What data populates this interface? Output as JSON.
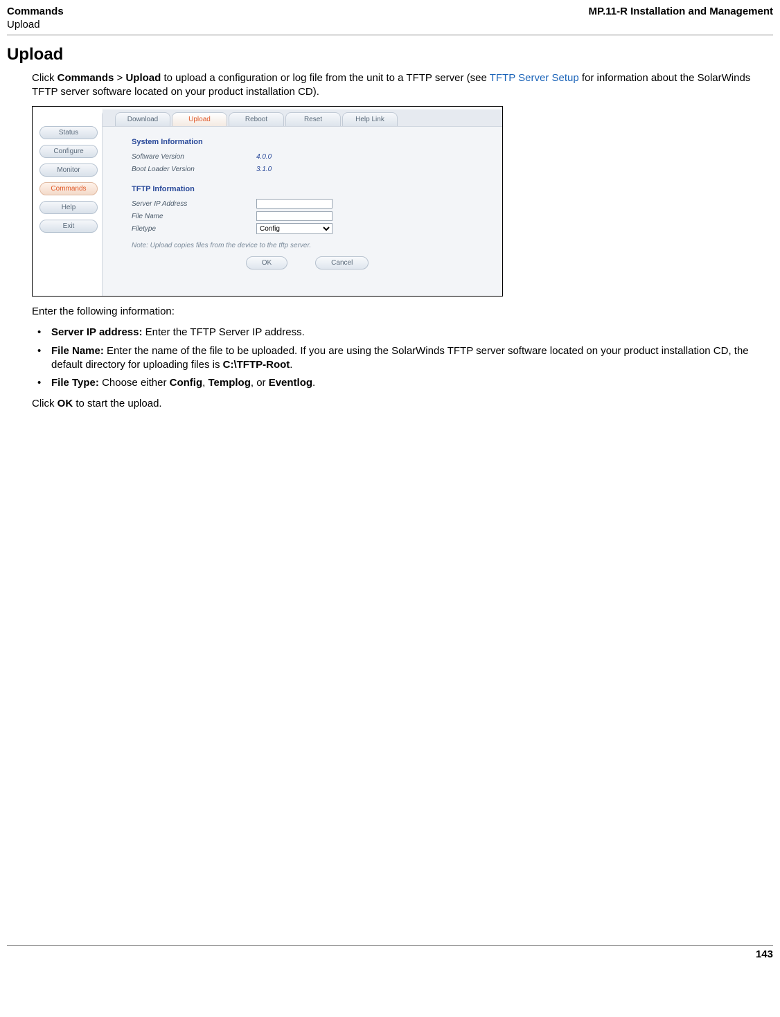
{
  "header": {
    "left_line1": "Commands",
    "left_line2": "Upload",
    "right": "MP.11-R Installation and Management"
  },
  "title": "Upload",
  "intro": {
    "pre": "Click ",
    "b1": "Commands",
    "sep": " > ",
    "b2": "Upload",
    "mid": " to upload a configuration or log file from the unit to a TFTP server (see ",
    "link": "TFTP Server Setup",
    "post": " for information about the SolarWinds TFTP server software located on your product installation CD)."
  },
  "figure": {
    "sidebar": {
      "items": [
        {
          "label": "Status",
          "active": false
        },
        {
          "label": "Configure",
          "active": false
        },
        {
          "label": "Monitor",
          "active": false
        },
        {
          "label": "Commands",
          "active": true
        },
        {
          "label": "Help",
          "active": false
        },
        {
          "label": "Exit",
          "active": false
        }
      ]
    },
    "tabs": [
      {
        "label": "Download",
        "active": false
      },
      {
        "label": "Upload",
        "active": true
      },
      {
        "label": "Reboot",
        "active": false
      },
      {
        "label": "Reset",
        "active": false
      },
      {
        "label": "Help Link",
        "active": false
      }
    ],
    "sysinfo": {
      "title": "System Information",
      "rows": [
        {
          "label": "Software Version",
          "value": "4.0.0"
        },
        {
          "label": "Boot Loader Version",
          "value": "3.1.0"
        }
      ]
    },
    "tftp": {
      "title": "TFTP Information",
      "server_ip_label": "Server IP Address",
      "server_ip_value": "",
      "file_name_label": "File Name",
      "file_name_value": "",
      "filetype_label": "Filetype",
      "filetype_value": "Config"
    },
    "note": "Note: Upload copies files from the device to the tftp server.",
    "buttons": {
      "ok": "OK",
      "cancel": "Cancel"
    }
  },
  "after_figure": "Enter the following information:",
  "bullets": [
    {
      "b": "Server IP address:",
      "rest": " Enter the TFTP Server IP address."
    },
    {
      "b": "File Name:",
      "rest_pre": " Enter the name of the file to be uploaded. If you are using the SolarWinds TFTP server software located on your product installation CD, the default directory for uploading files is ",
      "b2": "C:\\TFTP-Root",
      "rest_post": "."
    },
    {
      "b": "File Type:",
      "rest_pre": " Choose either ",
      "o1": "Config",
      "c1": ", ",
      "o2": "Templog",
      "c2": ", or ",
      "o3": "Eventlog",
      "rest_post": "."
    }
  ],
  "closing_pre": "Click ",
  "closing_b": "OK",
  "closing_post": " to start the upload.",
  "page_number": "143"
}
